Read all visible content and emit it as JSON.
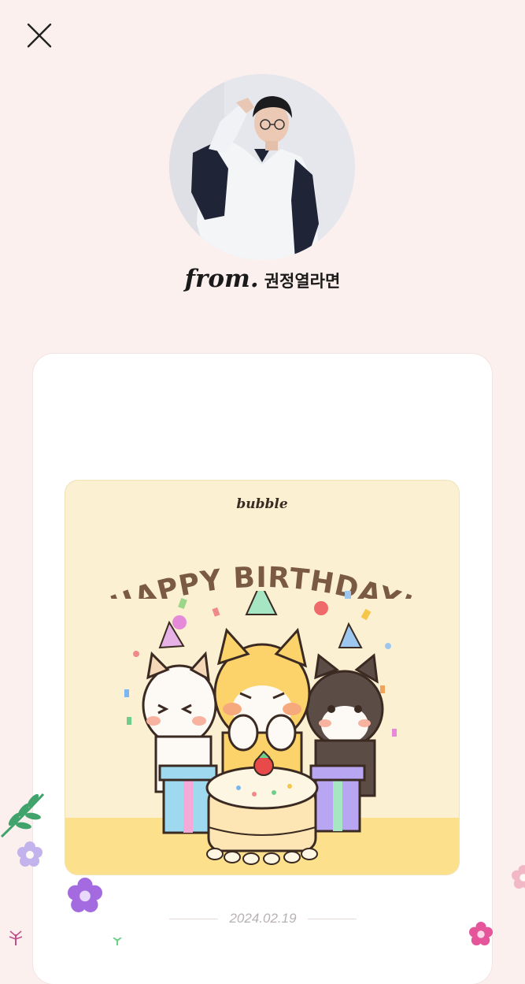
{
  "header": {
    "close_icon": "close-icon"
  },
  "sender": {
    "avatar": "profile-photo",
    "from_prefix": "from.",
    "name": "권정열라면"
  },
  "card": {
    "brand": "bubble",
    "title": "HAPPY BIRTHDAY!",
    "illustration": "three-dogs-birthday-cake"
  },
  "letter": {
    "date": "2024.02.19"
  },
  "colors": {
    "background": "#fcf0ef",
    "card_bg": "#fbf1d2",
    "card_floor": "#fde08c",
    "title_brown": "#7a5a45"
  }
}
